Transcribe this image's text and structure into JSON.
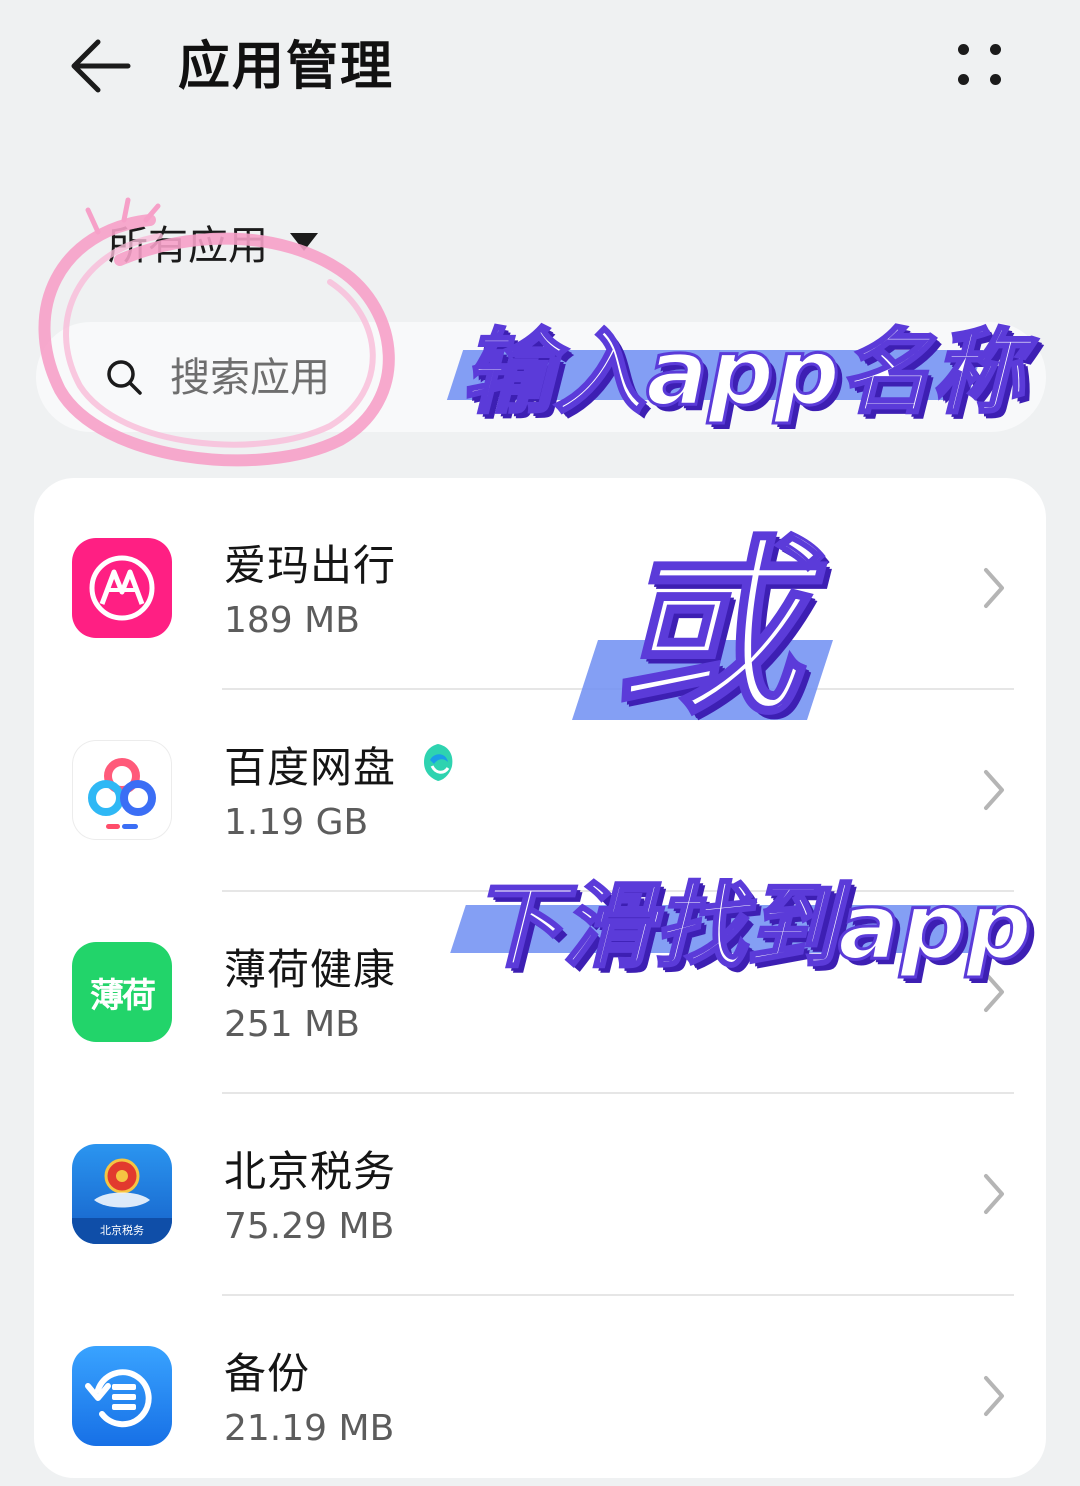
{
  "header": {
    "title": "应用管理"
  },
  "filter": {
    "label": "所有应用"
  },
  "search": {
    "placeholder": "搜索应用"
  },
  "apps": [
    {
      "name": "爱玛出行",
      "size": "189 MB",
      "icon": "aima-icon",
      "color": "#ff1f83"
    },
    {
      "name": "百度网盘",
      "size": "1.19 GB",
      "icon": "baidu-netdisk-icon",
      "badge": "verified-badge-icon"
    },
    {
      "name": "薄荷健康",
      "size": "251 MB",
      "icon": "boohee-icon",
      "icon_text": "薄荷",
      "color": "#22d46a"
    },
    {
      "name": "北京税务",
      "size": "75.29 MB",
      "icon": "beijing-tax-icon",
      "icon_text": "北京税务",
      "color": "#1b7fe0"
    },
    {
      "name": "备份",
      "size": "21.19 MB",
      "icon": "backup-icon",
      "color": "#1d86f0"
    }
  ],
  "overlay": {
    "line1": "输入app名称",
    "line2": "或",
    "line3": "下滑找到app",
    "highlight_color": "#f6a0c8",
    "text_color": "#5b3bd9",
    "bar_color": "#6f8ef2"
  }
}
